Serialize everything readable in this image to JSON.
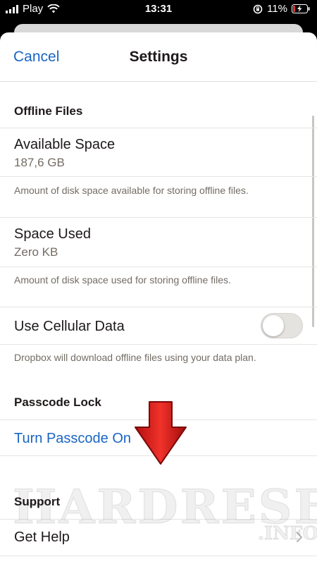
{
  "status_bar": {
    "carrier": "Play",
    "time": "13:31",
    "battery": "11%",
    "icons": [
      "signal-icon",
      "wifi-icon",
      "orientation-lock-icon",
      "battery-charging-icon"
    ]
  },
  "nav": {
    "cancel_label": "Cancel",
    "title": "Settings"
  },
  "offline_files": {
    "header": "Offline Files",
    "available_space": {
      "title": "Available Space",
      "value": "187,6 GB",
      "footnote": "Amount of disk space available for storing offline files."
    },
    "space_used": {
      "title": "Space Used",
      "value": "Zero KB",
      "footnote": "Amount of disk space used for storing offline files."
    },
    "cellular": {
      "title": "Use Cellular Data",
      "enabled": false,
      "footnote": "Dropbox will download offline files using your data plan."
    }
  },
  "passcode": {
    "header": "Passcode Lock",
    "action_label": "Turn Passcode On"
  },
  "support": {
    "header": "Support",
    "get_help_label": "Get Help"
  },
  "watermark": {
    "main": "HARDRESET",
    "sub": ".INFO"
  },
  "colors": {
    "accent": "#1a65c4",
    "arrow": "#e0261c"
  }
}
